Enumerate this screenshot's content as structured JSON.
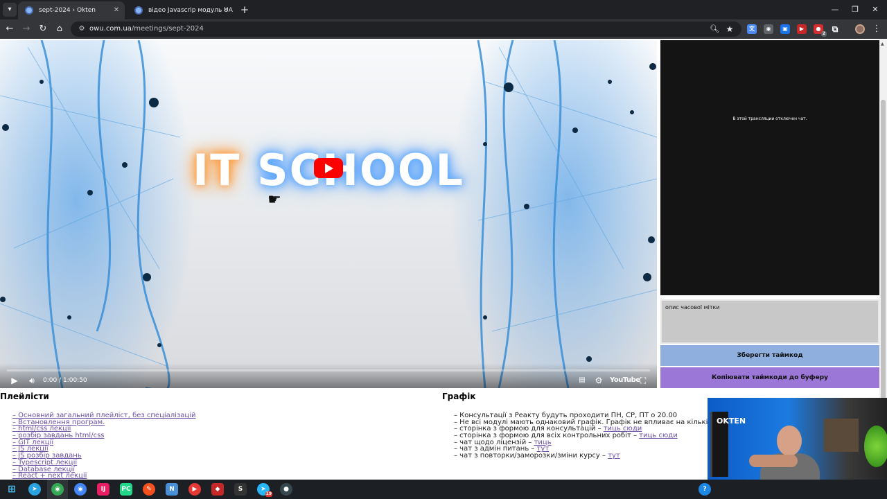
{
  "browser": {
    "tabs": [
      {
        "title": "sept-2024 › Okten",
        "active": true
      },
      {
        "title": "відео Javascrip модуль UA › Ok",
        "active": false
      }
    ],
    "new_tab": "+",
    "window_controls": {
      "minimize": "—",
      "restore": "❐",
      "close": "✕"
    },
    "address": {
      "host": "owu.com.ua",
      "path": "/meetings/sept-2024"
    },
    "extension_badges": {
      "ext6": "2"
    }
  },
  "video": {
    "title_it": "IT",
    "title_school": "SCHOOL",
    "time": "0:00 / 1:00:50",
    "brand": "YouTube",
    "progress_fraction": 0
  },
  "chat": {
    "disabled_message": "В этой трансляции отключен чат."
  },
  "timestamp": {
    "label": "опис часової мітки",
    "save_button": "Зберегти таймкод",
    "copy_button": "Копіювати таймкоди до буферу"
  },
  "playlists": {
    "title": "Плейлісти",
    "items": [
      "– Основний загальний плейліст, без спеціалізацій",
      "– Встановлення програм.",
      "– html/css лекції",
      "– розбір завдань html/css",
      "– GIT лекції",
      "– JS лекції",
      "– JS розбір завдань",
      "– Typescript лекції",
      "– Database лекції",
      "– React + next лекції"
    ]
  },
  "schedule": {
    "title": "Графік",
    "items": [
      {
        "text": "– Консультації з Реакту будуть проходити ПН, СР, ПТ о 20.00",
        "link": ""
      },
      {
        "text": "– Не всі модулі мають однаковий графік. Графік не впливає на кількість за",
        "link": ""
      },
      {
        "text": "– сторінка з формою для консультацій – ",
        "link": "тиць сюди"
      },
      {
        "text": "– сторінка з формою для всіх контрольних робіт – ",
        "link": "тиць сюди"
      },
      {
        "text": "– чат щодо ліцензій – ",
        "link": "тиць"
      },
      {
        "text": "– чат з адмін питань – ",
        "link": "тут"
      },
      {
        "text": "– чат з повторки/заморозки/зміни курсу – ",
        "link": "тут"
      }
    ]
  },
  "webcam": {
    "banner_text": "OKTEN"
  },
  "taskbar": {
    "badge": "19"
  }
}
